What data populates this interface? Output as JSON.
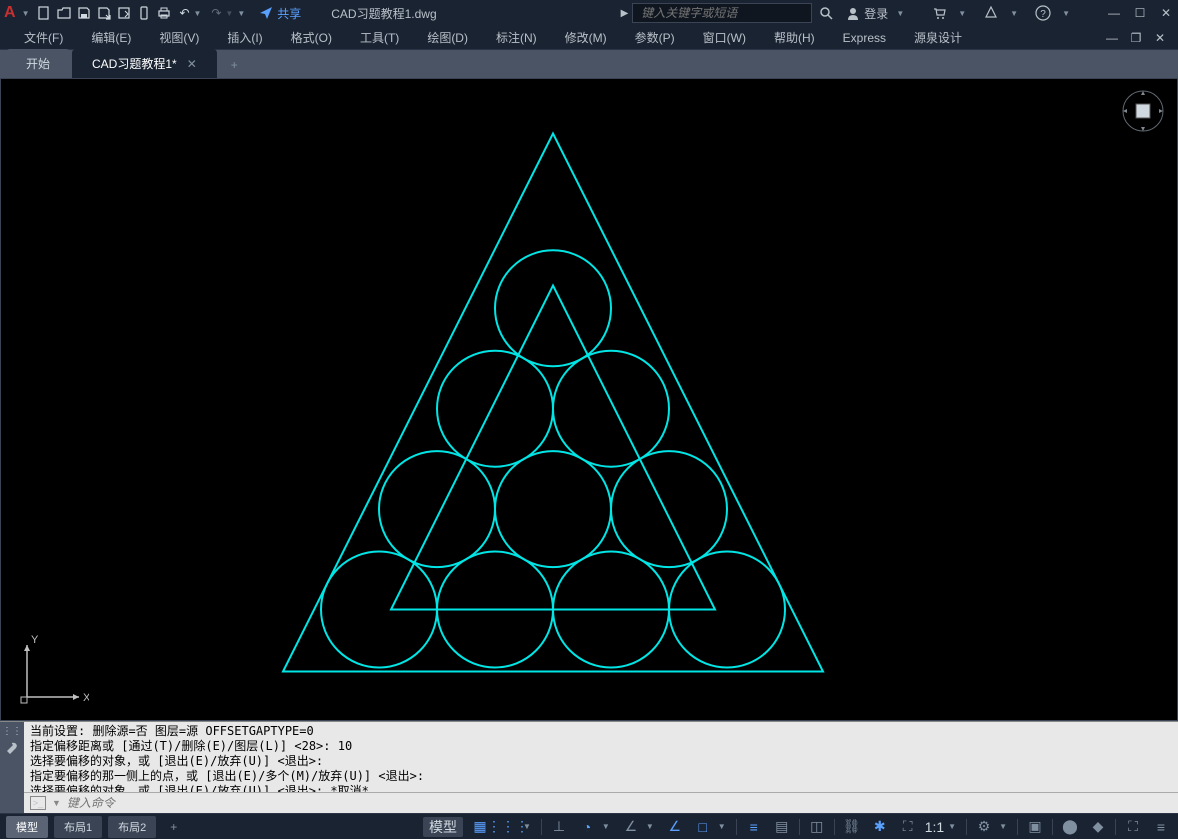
{
  "titlebar": {
    "share": "共享",
    "doc_title": "CAD习题教程1.dwg",
    "search_placeholder": "键入关键字或短语",
    "login": "登录"
  },
  "menu": {
    "items": [
      "文件(F)",
      "编辑(E)",
      "视图(V)",
      "插入(I)",
      "格式(O)",
      "工具(T)",
      "绘图(D)",
      "标注(N)",
      "修改(M)",
      "参数(P)",
      "窗口(W)",
      "帮助(H)",
      "Express",
      "源泉设计"
    ]
  },
  "tabs": {
    "start": "开始",
    "active": "CAD习题教程1*"
  },
  "cmd": {
    "lines": [
      "当前设置: 删除源=否  图层=源  OFFSETGAPTYPE=0",
      "指定偏移距离或 [通过(T)/删除(E)/图层(L)] <28>: 10",
      "选择要偏移的对象，或 [退出(E)/放弃(U)] <退出>:",
      "指定要偏移的那一侧上的点，或 [退出(E)/多个(M)/放弃(U)] <退出>:",
      "选择要偏移的对象，或 [退出(E)/放弃(U)] <退出>: *取消*"
    ],
    "input_placeholder": "键入命令"
  },
  "status": {
    "model": "模型",
    "layout1": "布局1",
    "layout2": "布局2",
    "model_btn": "模型",
    "scale": "1:1"
  },
  "drawing": {
    "stroke": "#00e5e5"
  }
}
